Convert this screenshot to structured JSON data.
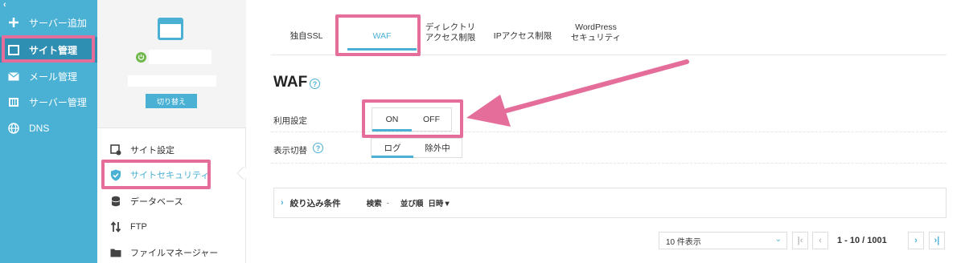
{
  "sidebar": {
    "collapse_glyph": "‹",
    "items": [
      {
        "label": "サーバー追加",
        "icon": "plus-icon"
      },
      {
        "label": "サイト管理",
        "icon": "window-icon"
      },
      {
        "label": "メール管理",
        "icon": "envelope-icon"
      },
      {
        "label": "サーバー管理",
        "icon": "server-icon"
      },
      {
        "label": "DNS",
        "icon": "globe-icon"
      }
    ]
  },
  "site_panel": {
    "switch_label": "切り替え",
    "menu": [
      {
        "label": "サイト設定",
        "icon": "site-settings-icon"
      },
      {
        "label": "サイトセキュリティ",
        "icon": "shield-check-icon"
      },
      {
        "label": "データベース",
        "icon": "database-icon"
      },
      {
        "label": "FTP",
        "icon": "transfer-arrows-icon"
      },
      {
        "label": "ファイルマネージャー",
        "icon": "folder-icon"
      }
    ]
  },
  "tabs": [
    {
      "label": "独自SSL"
    },
    {
      "label": "WAF"
    },
    {
      "label_line1": "ディレクトリ",
      "label_line2": "アクセス制限"
    },
    {
      "label": "IPアクセス制限"
    },
    {
      "label_line1": "WordPress",
      "label_line2": "セキュリティ"
    }
  ],
  "waf": {
    "title": "WAF",
    "help_glyph": "?",
    "usage_label": "利用設定",
    "usage_on": "ON",
    "usage_off": "OFF",
    "display_label": "表示切替",
    "display_log": "ログ",
    "display_excluded": "除外中"
  },
  "filter": {
    "label": "絞り込み条件",
    "search": "検索",
    "search_dash": "-",
    "sort": "並び順",
    "sort_value": "日時▼"
  },
  "pagination": {
    "per_page": "10 件表示",
    "range": "1 - 10 / 1001"
  },
  "colors": {
    "accent": "#4ab1d4",
    "highlight": "#e56d9a",
    "sidebar_active": "#2e8fb2"
  }
}
